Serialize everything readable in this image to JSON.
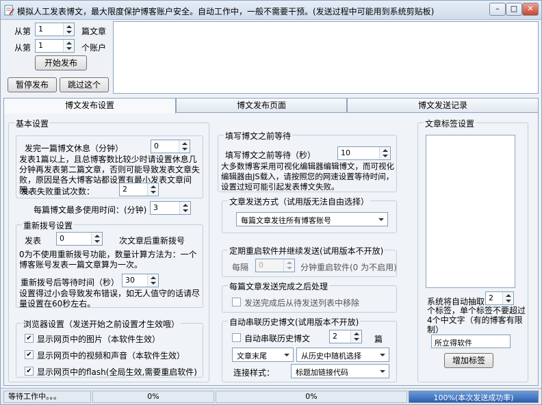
{
  "window": {
    "title": "模拟人工发表博文，最大限度保护博客账户安全。自动工作中，一般不需要干预。(发送过程中可能用到系统剪贴板)"
  },
  "top": {
    "from_label_1": "从第",
    "article_value": "1",
    "article_label": "篇文章",
    "from_label_2": "从第",
    "account_value": "1",
    "account_label": "个账户",
    "start_button": "开始发布",
    "pause_button": "暂停发布",
    "skip_button": "跳过这个"
  },
  "tabs": [
    "博文发布设置",
    "博文发布页面",
    "博文发送记录"
  ],
  "basic": {
    "title": "基本设置",
    "rest_label": "发完一篇博文休息（分钟）",
    "rest_value": "0",
    "rest_note": "发表1篇以上，且总博客数比较少时请设置休息几分钟再发表第二篇文章，否则可能导致发表文章失败，原因是各大博客站都设置有最小发表文章间隔。",
    "retry_label": "发表失败重试次数：",
    "retry_value": "2",
    "max_time_label": "每篇博文最多使用时间：(分钟)",
    "max_time_value": "3"
  },
  "redial": {
    "title": "重新拨号设置",
    "post_label": "发表",
    "post_value": "0",
    "after_label": "次文章后重新拨号",
    "note": "0为不使用重新拨号功能，数量计算方法为：一个博客账号发表一篇文章算为一次。",
    "wait_label": "重新拨号后等待时间（秒）",
    "wait_value": "30",
    "warn": "设置得过小会导致发布错误，如无人值守的话请尽量设置在60秒左右。"
  },
  "browser": {
    "title": "浏览器设置（发送开始之前设置才生效哦）",
    "opt_images": "显示网页中的图片（本软件生效）",
    "opt_video": "显示网页中的视频和声音（本软件生效）",
    "opt_flash": "显示网页中的flash(全局生效,需要重启软件)"
  },
  "fillwait": {
    "title": "填写博文之前等待",
    "label": "填写博文之前等待（秒）",
    "value": "10",
    "note": "大多数博客采用可视化编辑器编辑博文，而可视化编辑器由JS载入，请按照您的网速设置等待时间，设置过短可能引起发表博文失败。"
  },
  "sendmode": {
    "title": "文章发送方式（试用版无法自由选择）",
    "value": "每篇文章发往所有博客账号"
  },
  "restart": {
    "title": "定期重启软件并继续发送(试用版本不开放)",
    "every_label": "每隔",
    "value": "0",
    "unit_label": "分钟重启软件(0 为不启用)"
  },
  "after": {
    "title": "每篇文章发送完成之后处理",
    "option": "发送完成后从待发送列表中移除"
  },
  "history": {
    "title": "自动串联历史博文(试用版本不开放)",
    "option": "自动串联历史博文",
    "count": "2",
    "count_unit": "篇",
    "position": "文章末尾",
    "source": "从历史中随机选择",
    "style_label": "连接样式：",
    "style": "标题加链接代码"
  },
  "tags": {
    "title": "文章标签设置",
    "auto_label": "系统将自动抽取",
    "auto_value": "2",
    "auto_note": "个标签，单个标签不要超过4个中文字（有的博客有限制）",
    "input_value": "所立得软件",
    "add_button": "增加标签"
  },
  "status": {
    "text": "等待工作中。。。",
    "p1": "0%",
    "p2": "0%",
    "progress_text": "100%(本次发送成功率)",
    "progress": 1.0
  }
}
